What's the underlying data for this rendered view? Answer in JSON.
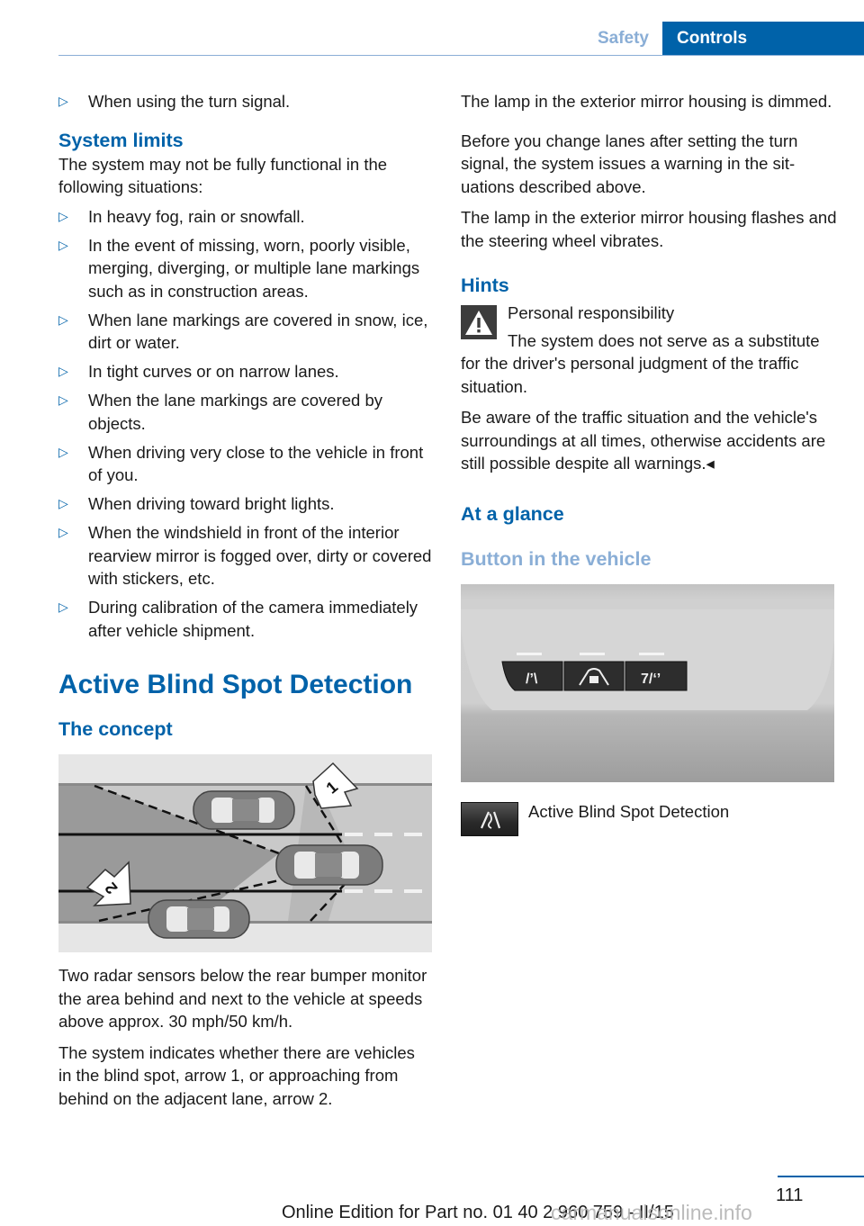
{
  "header": {
    "tabs": [
      {
        "label": "Safety",
        "active": false
      },
      {
        "label": "Controls",
        "active": true
      }
    ],
    "accent_color": "#0062a9",
    "inactive_color": "#8aaed6"
  },
  "left": {
    "intro_bullet": "When using the turn signal.",
    "system_limits": {
      "heading": "System limits",
      "intro": "The system may not be fully functional in the following situations:",
      "items": [
        "In heavy fog, rain or snowfall.",
        "In the event of missing, worn, poorly visi­ble, merging, diverging, or multiple lane markings such as in construction areas.",
        "When lane markings are covered in snow, ice, dirt or water.",
        "In tight curves or on narrow lanes.",
        "When the lane markings are covered by objects.",
        "When driving very close to the vehicle in front of you.",
        "When driving toward bright lights.",
        "When the windshield in front of the interior rearview mirror is fogged over, dirty or cov­ered with stickers, etc.",
        "During calibration of the camera immedi­ately after vehicle shipment."
      ]
    },
    "section_title": "Active Blind Spot Detection",
    "concept_heading": "The concept",
    "figure": {
      "arrow_1_label": "1",
      "arrow_2_label": "2"
    },
    "para1": "Two radar sensors below the rear bumper monitor the area behind and next to the vehicle at speeds above approx. 30 mph/50 km/h.",
    "para2": "The system indicates whether there are vehi­cles in the blind spot, arrow 1, or approaching from behind on the adjacent lane, arrow 2."
  },
  "right": {
    "para1": "The lamp in the exterior mirror housing is dim­med.",
    "para2": "Before you change lanes after setting the turn signal, the system issues a warning in the sit­uations described above.",
    "para3": "The lamp in the exterior mirror housing flashes and the steering wheel vibrates.",
    "hints_heading": "Hints",
    "warning_title": "Personal responsibility",
    "warning_text": "The system does not serve as a substi­tute for the driver's personal judgment of the traffic situation.",
    "warning_text2": "Be aware of the traffic situation and the vehi­cle's surroundings at all times, otherwise acci­dents are still possible despite all warnings.◂",
    "glance_heading": "At a glance",
    "button_heading": "Button in the vehicle",
    "button_legend": "Active Blind Spot Detection"
  },
  "footer": {
    "page_number": "111",
    "edition": "Online Edition for Part no. 01 40 2 960 759 - II/15",
    "watermark": "carmanualsonline.info"
  }
}
